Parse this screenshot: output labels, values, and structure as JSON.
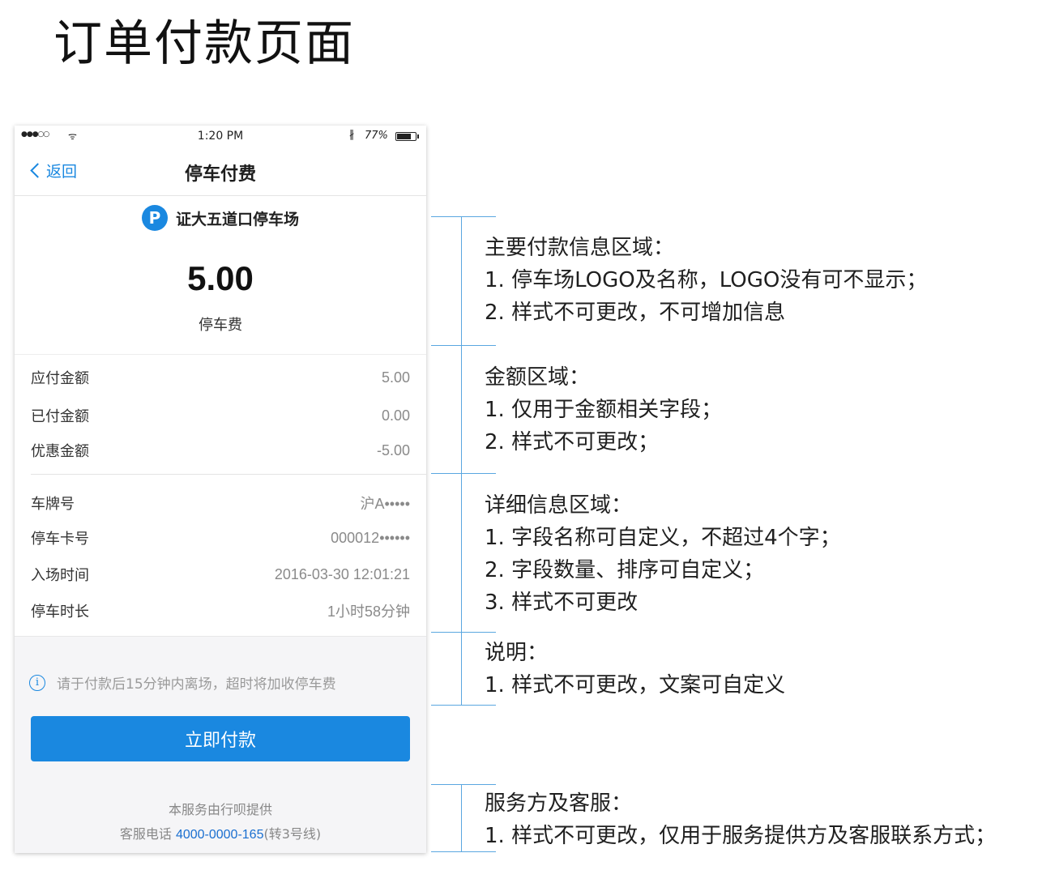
{
  "page_title": "订单付款页面",
  "status_bar": {
    "signal": "●●●○○",
    "wifi": "ᯤ",
    "time": "1:20 PM",
    "bluetooth": "∦",
    "battery_pct": "77%"
  },
  "nav": {
    "back_label": "返回",
    "title": "停车付费"
  },
  "lot": {
    "logo_letter": "P",
    "name": "证大五道口停车场"
  },
  "amount": {
    "value": "5.00",
    "label": "停车费"
  },
  "fee_rows": [
    {
      "label": "应付金额",
      "value": "5.00"
    },
    {
      "label": "已付金额",
      "value": "0.00"
    },
    {
      "label": "优惠金额",
      "value": "-5.00"
    }
  ],
  "detail_rows": [
    {
      "label": "车牌号",
      "value": "沪A•••••"
    },
    {
      "label": "停车卡号",
      "value": "000012••••••"
    },
    {
      "label": "入场时间",
      "value": "2016-03-30 12:01:21"
    },
    {
      "label": "停车时长",
      "value": "1小时58分钟"
    }
  ],
  "notice": {
    "icon": "i",
    "text": "请于付款后15分钟内离场，超时将加收停车费"
  },
  "pay_button": "立即付款",
  "provider": {
    "text": "本服务由行呗提供",
    "hotline_prefix": "客服电话 ",
    "hotline_number": "4000-0000-165",
    "hotline_suffix": "(转3号线)"
  },
  "annotations": [
    {
      "lines": [
        "主要付款信息区域：",
        "1.  停车场LOGO及名称，LOGO没有可不显示；",
        "2.  样式不可更改，不可增加信息"
      ]
    },
    {
      "lines": [
        "金额区域：",
        "1.  仅用于金额相关字段；",
        "2.  样式不可更改；"
      ]
    },
    {
      "lines": [
        "详细信息区域：",
        "1.  字段名称可自定义，不超过4个字；",
        "2.  字段数量、排序可自定义；",
        "3.  样式不可更改"
      ]
    },
    {
      "lines": [
        "说明：",
        "1. 样式不可更改，文案可自定义"
      ]
    },
    {
      "lines": [
        "服务方及客服：",
        "1. 样式不可更改，仅用于服务提供方及客服联系方式；"
      ]
    }
  ],
  "colors": {
    "accent": "#1a88e0",
    "bracket": "#5aa7e0",
    "footer_bg": "#f5f5f7"
  }
}
